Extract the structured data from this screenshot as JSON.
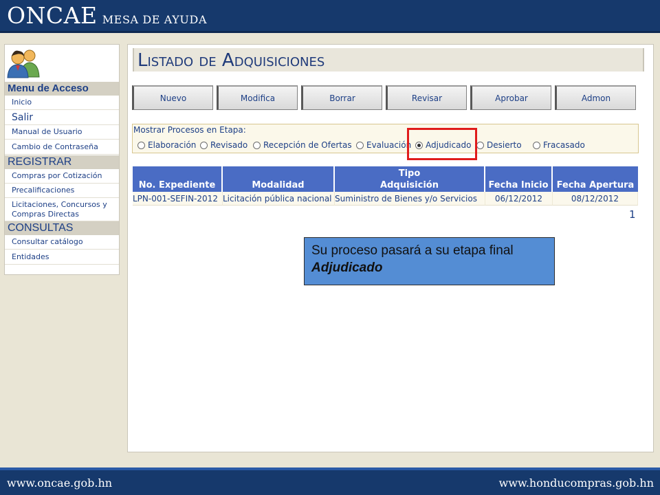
{
  "header": {
    "logo_main": "ONCAE",
    "logo_sub": "MESA DE AYUDA"
  },
  "sidebar": {
    "menu_title": "Menu de Acceso",
    "menu_items": [
      "Inicio",
      "Salir",
      "Manual de Usuario",
      "Cambio de Contraseña"
    ],
    "register_title": "REGISTRAR",
    "register_items": [
      "Compras por Cotización",
      "Precalificaciones",
      "Licitaciones, Concursos y Compras Directas"
    ],
    "consult_title": "CONSULTAS",
    "consult_items": [
      "Consultar catálogo",
      "Entidades"
    ]
  },
  "page": {
    "title": "Listado de Adquisiciones"
  },
  "toolbar": {
    "buttons": [
      "Nuevo",
      "Modifica",
      "Borrar",
      "Revisar",
      "Aprobar",
      "Admon"
    ]
  },
  "filter": {
    "label": "Mostrar Procesos en Etapa:",
    "options": [
      "Elaboración",
      "Revisado",
      "Recepción de Ofertas",
      "Evaluación",
      "Adjudicado",
      "Desierto",
      "Fracasado"
    ],
    "selected": "Adjudicado"
  },
  "table": {
    "headers": [
      "No. Expediente",
      "Modalidad",
      "Tipo Adquisición",
      "Fecha Inicio",
      "Fecha Apertura"
    ],
    "header_lines": {
      "tipo_line1": "Tipo",
      "tipo_line2": "Adquisición"
    },
    "rows": [
      [
        "LPN-001-SEFIN-2012",
        "Licitación pública nacional",
        "Suministro de Bienes y/o Servicios",
        "06/12/2012",
        "08/12/2012"
      ]
    ]
  },
  "pager": {
    "current": "1"
  },
  "callout": {
    "line1": "Su proceso pasará a su etapa final",
    "line2": "Adjudicado"
  },
  "footer": {
    "left": "www.oncae.gob.hn",
    "right": "www.honducompras.gob.hn"
  },
  "colors": {
    "header_bg": "#16396c",
    "table_header": "#4a6cc4",
    "callout_bg": "#548dd4",
    "highlight": "#e01b1b",
    "link_text": "#1d3f86"
  }
}
